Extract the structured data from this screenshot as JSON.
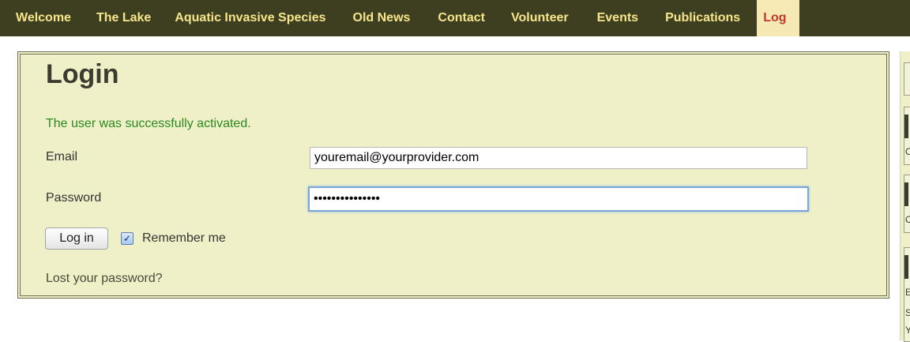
{
  "nav": {
    "items": [
      {
        "label": "Welcome"
      },
      {
        "label": "The Lake"
      },
      {
        "label": "Aquatic Invasive Species"
      },
      {
        "label": "Old News"
      },
      {
        "label": "Contact"
      },
      {
        "label": "Volunteer"
      },
      {
        "label": "Events"
      },
      {
        "label": "Publications"
      },
      {
        "label": "Log"
      }
    ]
  },
  "login": {
    "title": "Login",
    "success_message": "The user was successfully activated.",
    "email_label": "Email",
    "email_value": "youremail@yourprovider.com",
    "password_label": "Password",
    "password_value": "•••••••••••••••",
    "login_button": "Log in",
    "remember_label": "Remember me",
    "remember_checked": true,
    "lost_password": "Lost your password?"
  },
  "sidebar": {
    "letters": [
      "C",
      "C",
      "E",
      "S",
      "Y"
    ]
  },
  "colors": {
    "nav_bg": "#3e3f20",
    "nav_text": "#f6e58a",
    "nav_active_text": "#c0392b",
    "panel_bg": "#eff0c8",
    "success": "#2a8a1f"
  }
}
